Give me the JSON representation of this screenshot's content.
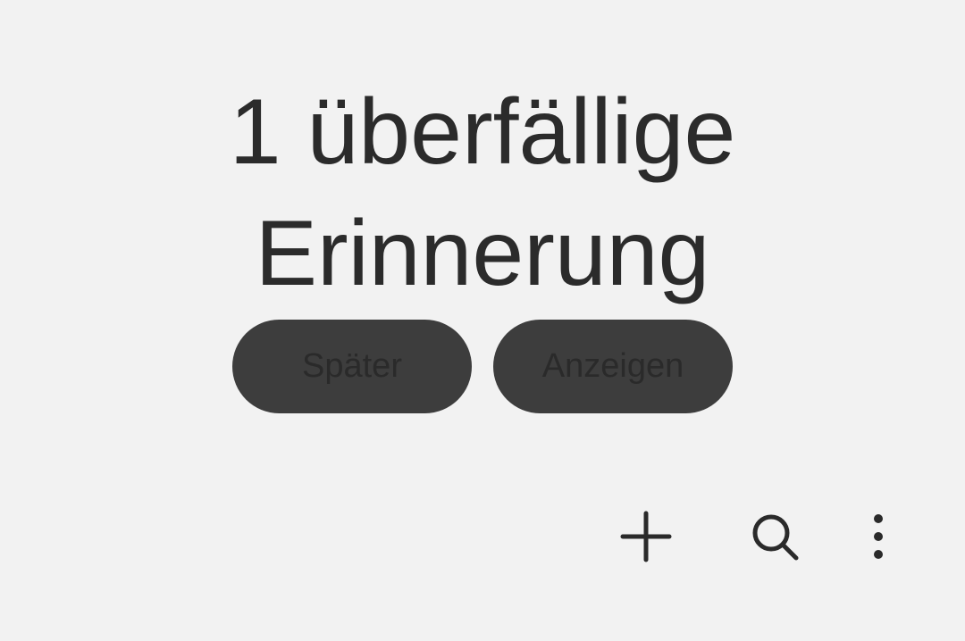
{
  "reminder": {
    "title_line1": "1 überfällige",
    "title_line2": "Erinnerung",
    "later_label": "Später",
    "show_label": "Anzeigen"
  },
  "toolbar": {
    "icons": [
      "add-icon",
      "search-icon",
      "more-vert-icon"
    ]
  },
  "colors": {
    "background": "#f2f2f2",
    "text": "#2b2b2b",
    "button": "#3d3d3d"
  }
}
